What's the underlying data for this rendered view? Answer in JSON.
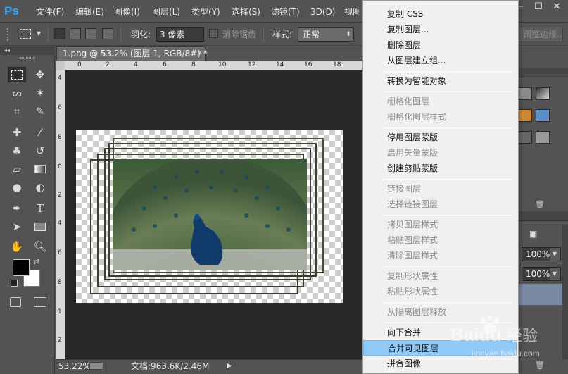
{
  "app": {
    "logo_text": "Ps",
    "accent": "#31a8ff"
  },
  "menubar": {
    "items": [
      "文件(F)",
      "编辑(E)",
      "图像(I)",
      "图层(L)",
      "类型(Y)",
      "选择(S)",
      "滤镜(T)",
      "3D(D)",
      "视图"
    ],
    "window_controls": [
      "−",
      "☐",
      "✕"
    ]
  },
  "options_bar": {
    "feather_label": "羽化:",
    "feather_value": "3 像素",
    "antialias_label": "消除锯齿",
    "style_label": "样式:",
    "style_value": "正常",
    "refine_edge_label": "调整边缘..."
  },
  "tools": {
    "icons": [
      "marquee-icon",
      "move-icon",
      "lasso-icon",
      "magic-wand-icon",
      "crop-icon",
      "eyedropper-icon",
      "healing-brush-icon",
      "brush-icon",
      "clone-stamp-icon",
      "history-brush-icon",
      "eraser-icon",
      "gradient-icon",
      "blur-icon",
      "dodge-icon",
      "pen-icon",
      "type-icon",
      "path-selection-icon",
      "rectangle-icon",
      "hand-icon",
      "zoom-icon"
    ],
    "foreground_color": "#000000",
    "background_color": "#ffffff"
  },
  "document": {
    "tab_title": "1.png @ 53.2% (图层 1, RGB/8#) *",
    "tab_close": "×",
    "ruler_top_ticks": [
      "0",
      "2",
      "4",
      "6",
      "8",
      "10",
      "12",
      "14",
      "16",
      "18"
    ],
    "ruler_left_ticks": [
      "4",
      "6",
      "8",
      "0",
      "2",
      "4",
      "6",
      "8",
      "1",
      "2"
    ]
  },
  "status_bar": {
    "zoom": "53.22%",
    "doc_size": "文档:963.6K/2.46M",
    "arrow": "▶"
  },
  "right_panel": {
    "opacity_value": "100%",
    "fill_value": "100%"
  },
  "context_menu": {
    "items": [
      {
        "label": "复制 CSS",
        "disabled": false
      },
      {
        "label": "复制图层...",
        "disabled": false
      },
      {
        "label": "删除图层",
        "disabled": false
      },
      {
        "label": "从图层建立组...",
        "disabled": false
      },
      {
        "label": "转换为智能对象",
        "disabled": false
      },
      {
        "label": "栅格化图层",
        "disabled": true
      },
      {
        "label": "栅格化图层样式",
        "disabled": true
      },
      {
        "label": "停用图层蒙版",
        "disabled": false
      },
      {
        "label": "启用矢量蒙版",
        "disabled": true
      },
      {
        "label": "创建剪贴蒙版",
        "disabled": false
      },
      {
        "label": "链接图层",
        "disabled": true
      },
      {
        "label": "选择链接图层",
        "disabled": true
      },
      {
        "label": "拷贝图层样式",
        "disabled": true
      },
      {
        "label": "粘贴图层样式",
        "disabled": true
      },
      {
        "label": "清除图层样式",
        "disabled": true
      },
      {
        "label": "复制形状属性",
        "disabled": true
      },
      {
        "label": "粘贴形状属性",
        "disabled": true
      },
      {
        "label": "从隔离图层释放",
        "disabled": true
      },
      {
        "label": "向下合并",
        "disabled": false
      },
      {
        "label": "合并可见图层",
        "disabled": false,
        "highlighted": true
      },
      {
        "label": "拼合图像",
        "disabled": false
      }
    ],
    "highlight_color": "#91c9f7"
  },
  "watermark": {
    "brand": "Baidu",
    "suffix": "经验",
    "url": "jingyan.baidu.com"
  }
}
